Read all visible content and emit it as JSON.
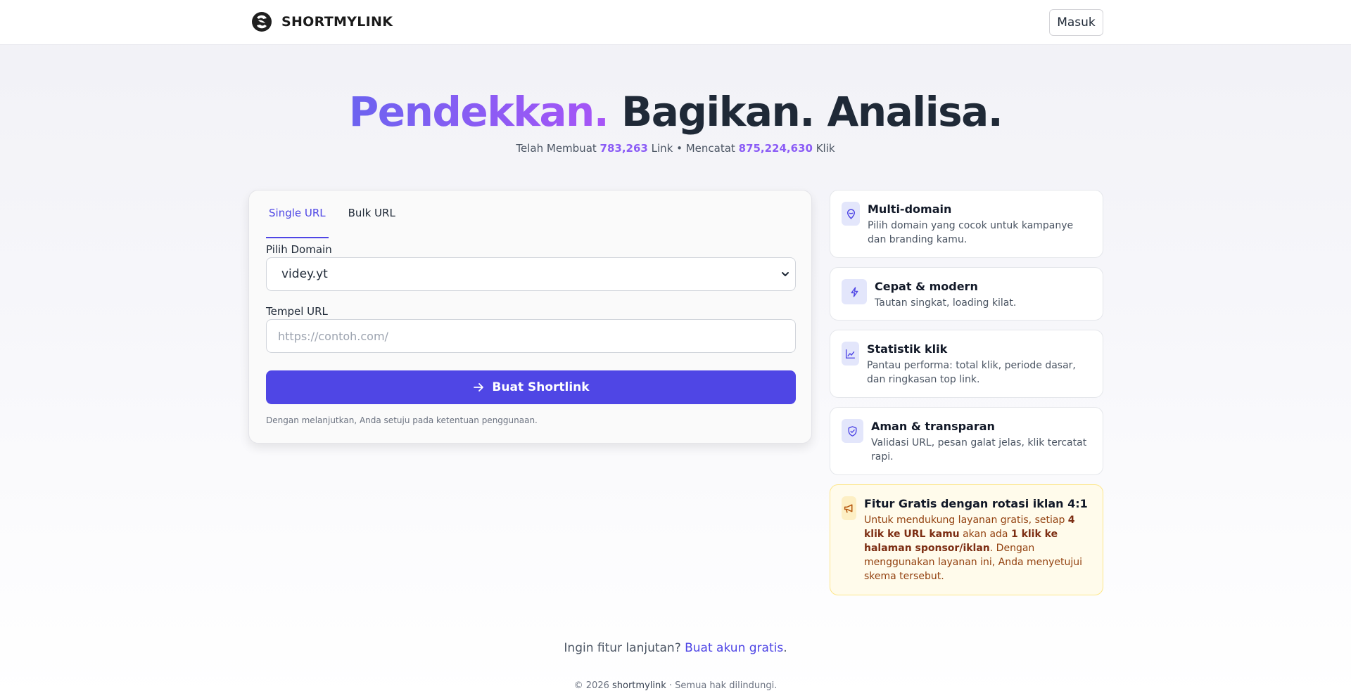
{
  "header": {
    "brand_name": "SHORTMYLINK",
    "login_label": "Masuk"
  },
  "hero": {
    "title_highlight": "Pendekkan.",
    "title_rest": " Bagikan. Analisa.",
    "stats_prefix": "Telah Membuat ",
    "links_count": "783,263",
    "stats_middle": " Link • Mencatat ",
    "clicks_count": "875,224,630",
    "stats_suffix": " Klik"
  },
  "form": {
    "tabs": [
      {
        "label": "Single URL",
        "active": true
      },
      {
        "label": "Bulk URL",
        "active": false
      }
    ],
    "domain_label": "Pilih Domain",
    "domain_selected": "videy.yt",
    "url_label": "Tempel URL",
    "url_value": "",
    "url_placeholder": "https://contoh.com/",
    "submit_label": "Buat Shortlink",
    "terms": "Dengan melanjutkan, Anda setuju pada ketentuan penggunaan."
  },
  "features": [
    {
      "icon": "map-pin-icon",
      "title": "Multi-domain",
      "desc": "Pilih domain yang cocok untuk kampanye dan branding kamu."
    },
    {
      "icon": "lightning-icon",
      "title": "Cepat & modern",
      "desc": "Tautan singkat, loading kilat."
    },
    {
      "icon": "line-chart-icon",
      "title": "Statistik klik",
      "desc": "Pantau performa: total klik, periode dasar, dan ringkasan top link."
    },
    {
      "icon": "shield-check-icon",
      "title": "Aman & transparan",
      "desc": "Validasi URL, pesan galat jelas, klik tercatat rapi."
    }
  ],
  "promo": {
    "icon": "megaphone-icon",
    "title": "Fitur Gratis dengan rotasi iklan 4:1",
    "desc_1": "Untuk mendukung layanan gratis, setiap ",
    "bold_1": "4 klik ke URL kamu",
    "desc_2": " akan ada ",
    "bold_2": "1 klik ke halaman sponsor/iklan",
    "desc_3": ". Dengan menggunakan layanan ini, Anda menyetujui skema tersebut."
  },
  "footer": {
    "cta_text": "Ingin fitur lanjutan? ",
    "cta_link": "Buat akun gratis",
    "cta_end": ".",
    "copyright_prefix": "© 2026 ",
    "copyright_brand": "shortmylink",
    "copyright_suffix": " · Semua hak dilindungi."
  },
  "colors": {
    "primary": "#4f46e5",
    "accent_purple": "#8b5cf6",
    "promo_background": "#fffbeb",
    "promo_text": "#92400e"
  }
}
